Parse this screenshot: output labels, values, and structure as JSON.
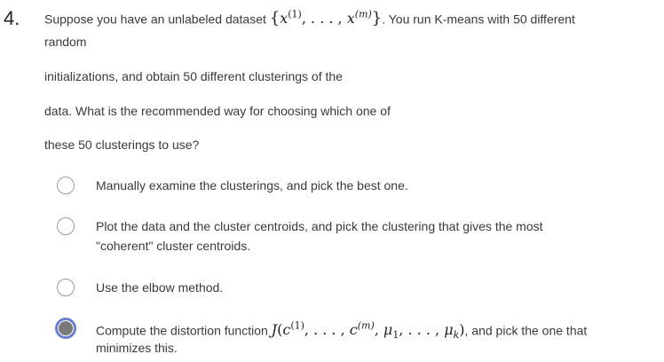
{
  "question": {
    "number": "4.",
    "line1_prefix": "Suppose you have an unlabeled dataset",
    "line1_suffix": ". You run K-means with 50 different",
    "set_open": "{",
    "set_x": "x",
    "set_sup1": "(1)",
    "set_dots": ", . . . , ",
    "set_sup2": "(m)",
    "set_close": "}",
    "line2": "random",
    "line3": "initializations, and obtain 50 different clusterings of the",
    "line4": "data. What is the recommended way for choosing which one of",
    "line5": "these 50 clusterings to use?"
  },
  "options": [
    {
      "label": "Manually examine the clusterings, and pick the best one.",
      "selected": false
    },
    {
      "label_line1": "Plot the data and the cluster centroids, and pick the clustering that gives the most",
      "label_line2": "\"coherent\" cluster centroids.",
      "selected": false
    },
    {
      "label": "Use the elbow method.",
      "selected": false
    },
    {
      "label_prefix": "Compute the distortion function",
      "label_suffix": ", and pick the one that",
      "label_line2": "minimizes this.",
      "math_J": "J",
      "math_c": "c",
      "math_sup1": "(1)",
      "math_dots": ", . . . , ",
      "math_sup2": "(m)",
      "math_mu": "μ",
      "math_sub1": "1",
      "math_subk": "k",
      "selected": true
    }
  ],
  "colors": {
    "selected_ring": "#6b7fd8",
    "selected_dot": "#7a7a7a",
    "radio_border": "#9a9a9a",
    "text": "#373a3c"
  }
}
